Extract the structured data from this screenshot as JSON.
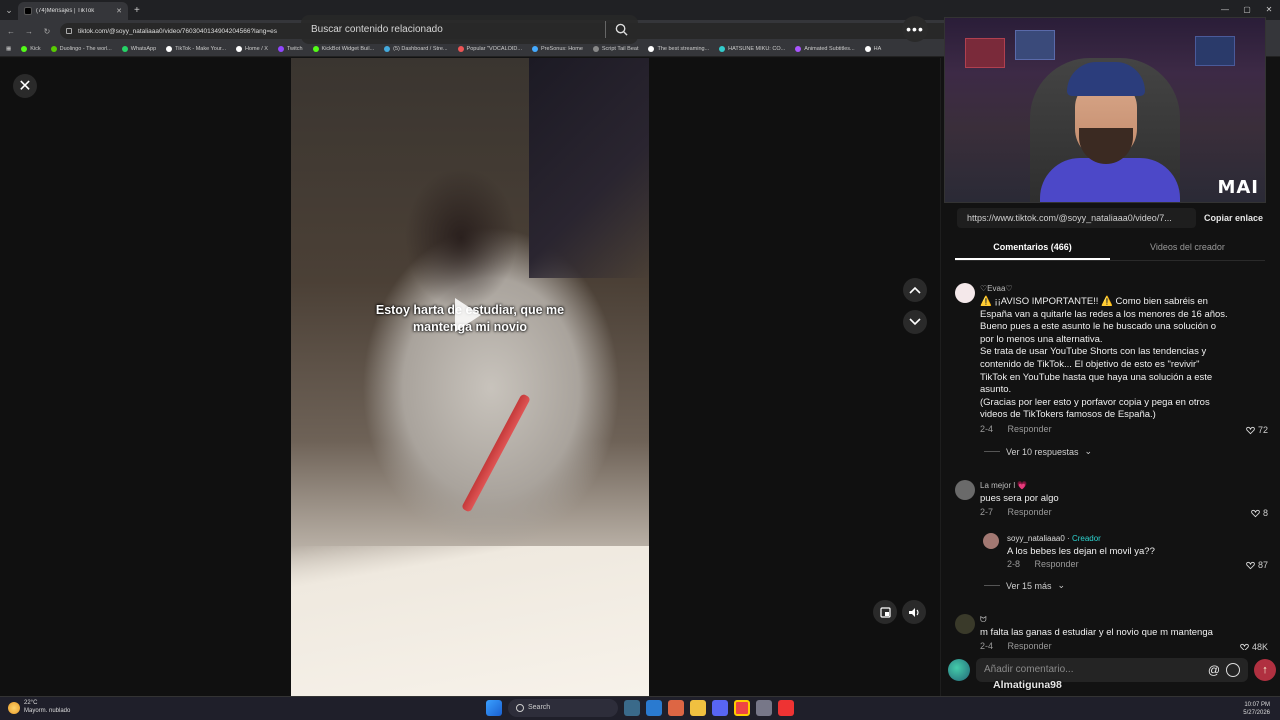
{
  "browser": {
    "tab_title": "(74)Mensajes | TikTok",
    "url": "tiktok.com/@soyy_nataliaaa0/video/7603040134904204566?lang=es",
    "bookmarks": [
      {
        "label": "Kick",
        "color": "#53fc18"
      },
      {
        "label": "Duolingo - The worl...",
        "color": "#58cc02"
      },
      {
        "label": "WhatsApp",
        "color": "#25d366"
      },
      {
        "label": "TikTok - Make Your...",
        "color": "#ffffff"
      },
      {
        "label": "Home / X",
        "color": "#ffffff"
      },
      {
        "label": "Twitch",
        "color": "#9146ff"
      },
      {
        "label": "KickBot Widget Buil...",
        "color": "#53fc18"
      },
      {
        "label": "(5) Dashboard / Stre...",
        "color": "#4ad"
      },
      {
        "label": "Popular \"VOCALOID...",
        "color": "#e55"
      },
      {
        "label": "PreSonus: Home",
        "color": "#4af"
      },
      {
        "label": "Script Tail Beat",
        "color": "#888"
      },
      {
        "label": "The best streaming...",
        "color": "#fff"
      },
      {
        "label": "HATSUNE MIKU: CO...",
        "color": "#3cc"
      },
      {
        "label": "Animated Subtitles...",
        "color": "#a5f"
      },
      {
        "label": "HA",
        "color": "#fff"
      }
    ]
  },
  "player": {
    "search_placeholder": "Buscar contenido relacionado",
    "caption_line1": "Estoy harta de estudiar, que me",
    "caption_line2": "mantenga mi novio"
  },
  "webcam": {
    "overlay": "MAI"
  },
  "panel": {
    "link": "https://www.tiktok.com/@soyy_nataliaaa0/video/7...",
    "copy_label": "Copiar enlace",
    "tab_comments": "Comentarios (466)",
    "tab_creator": "Videos del creador"
  },
  "comments": [
    {
      "author": "♡Evaa♡",
      "text": "⚠️ ¡¡AVISO IMPORTANTE!! ⚠️ Como bien sabréis en España van a quitarle las redes a los menores de 16 años. Bueno pues a este asunto le he buscado una solución o por lo menos una alternativa.\nSe trata de usar YouTube Shorts con las tendencias y contenido de TikTok... El objetivo de esto es \"revivir\" TikTok en YouTube hasta que haya una solución a este asunto.\n(Gracias por leer esto y porfavor copia y pega en otros videos de TikTokers famosos de España.)",
      "date": "2-4",
      "reply": "Responder",
      "likes": "72",
      "more": "Ver 10 respuestas"
    },
    {
      "author": "La mejor l 💗",
      "text": "pues sera por algo",
      "date": "2-7",
      "reply": "Responder",
      "likes": "8"
    },
    {
      "author": "soyy_nataliaaa0",
      "badge": "Creador",
      "text": "A los bebes les dejan el movil ya??",
      "date": "2-8",
      "reply": "Responder",
      "likes": "87",
      "more": "Ver 15 más"
    },
    {
      "author": "ᗢ",
      "text": "m falta las ganas d estudiar y el novio que m mantenga",
      "date": "2-4",
      "reply": "Responder",
      "likes": "48K"
    }
  ],
  "compose": {
    "placeholder": "Añadir comentario...",
    "at": "@"
  },
  "overlay_username": "Almatiguna98",
  "taskbar": {
    "temp": "22°C",
    "weather": "Mayorm. nublado",
    "search": "Search",
    "time": "10:07 PM",
    "date": "5/27/2026"
  }
}
